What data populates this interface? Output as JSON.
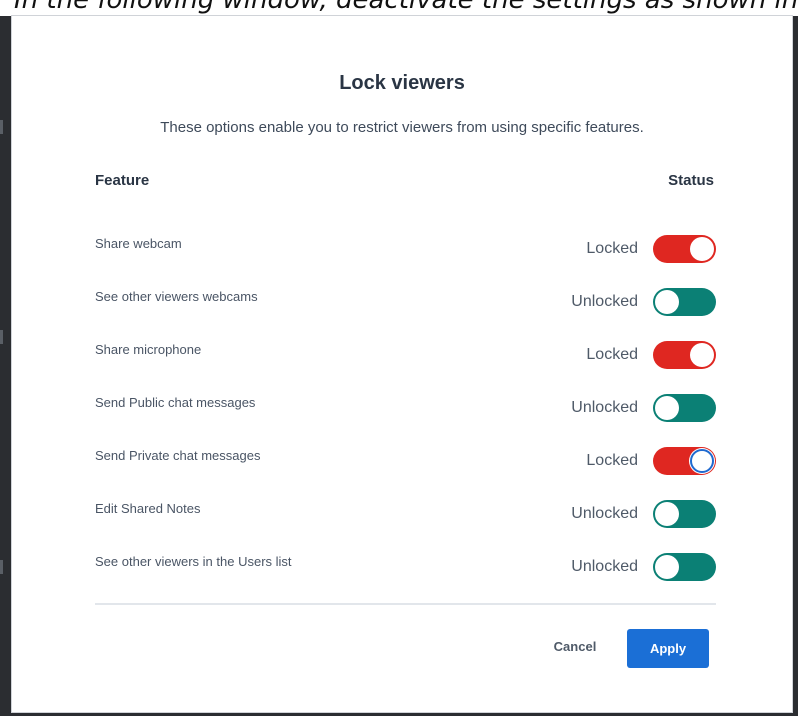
{
  "caption": "In the following window, deactivate the settings as shown in",
  "dialog": {
    "title": "Lock viewers",
    "subtitle": "These options enable you to restrict viewers from using specific features.",
    "columns": {
      "feature": "Feature",
      "status": "Status"
    },
    "rows": [
      {
        "label": "Share webcam",
        "status": "Locked",
        "locked": true,
        "focused": false
      },
      {
        "label": "See other viewers webcams",
        "status": "Unlocked",
        "locked": false,
        "focused": false
      },
      {
        "label": "Share microphone",
        "status": "Locked",
        "locked": true,
        "focused": false
      },
      {
        "label": "Send Public chat messages",
        "status": "Unlocked",
        "locked": false,
        "focused": false
      },
      {
        "label": "Send Private chat messages",
        "status": "Locked",
        "locked": true,
        "focused": true
      },
      {
        "label": "Edit Shared Notes",
        "status": "Unlocked",
        "locked": false,
        "focused": false
      },
      {
        "label": "See other viewers in the Users list",
        "status": "Unlocked",
        "locked": false,
        "focused": false
      }
    ],
    "buttons": {
      "cancel": "Cancel",
      "apply": "Apply"
    }
  },
  "colors": {
    "locked": "#df2721",
    "unlocked": "#0b8075",
    "apply": "#1b6fd6",
    "focus_ring": "#1f6ad0"
  }
}
